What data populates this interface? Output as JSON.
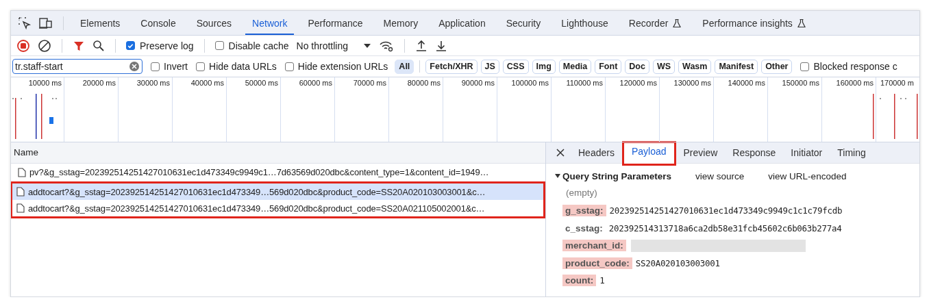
{
  "main_tabs": [
    {
      "label": "Elements",
      "selected": false,
      "experimental": false
    },
    {
      "label": "Console",
      "selected": false,
      "experimental": false
    },
    {
      "label": "Sources",
      "selected": false,
      "experimental": false
    },
    {
      "label": "Network",
      "selected": true,
      "experimental": false
    },
    {
      "label": "Performance",
      "selected": false,
      "experimental": false
    },
    {
      "label": "Memory",
      "selected": false,
      "experimental": false
    },
    {
      "label": "Application",
      "selected": false,
      "experimental": false
    },
    {
      "label": "Security",
      "selected": false,
      "experimental": false
    },
    {
      "label": "Lighthouse",
      "selected": false,
      "experimental": false
    },
    {
      "label": "Recorder",
      "selected": false,
      "experimental": true
    },
    {
      "label": "Performance insights",
      "selected": false,
      "experimental": true
    }
  ],
  "toolbar": {
    "recording": true,
    "preserve_log": {
      "label": "Preserve log",
      "checked": true
    },
    "disable_cache": {
      "label": "Disable cache",
      "checked": false
    },
    "throttling": "No throttling"
  },
  "filter": {
    "value": "tr.staff-start",
    "checkboxes": [
      {
        "label": "Invert",
        "checked": false
      },
      {
        "label": "Hide data URLs",
        "checked": false
      },
      {
        "label": "Hide extension URLs",
        "checked": false
      }
    ],
    "types": [
      {
        "label": "All",
        "selected": true
      },
      {
        "label": "Fetch/XHR",
        "selected": false
      },
      {
        "label": "JS",
        "selected": false
      },
      {
        "label": "CSS",
        "selected": false
      },
      {
        "label": "Img",
        "selected": false
      },
      {
        "label": "Media",
        "selected": false
      },
      {
        "label": "Font",
        "selected": false
      },
      {
        "label": "Doc",
        "selected": false
      },
      {
        "label": "WS",
        "selected": false
      },
      {
        "label": "Wasm",
        "selected": false
      },
      {
        "label": "Manifest",
        "selected": false
      },
      {
        "label": "Other",
        "selected": false
      }
    ],
    "blocked": {
      "label": "Blocked response c",
      "checked": false
    }
  },
  "timeline": {
    "ticks": [
      "10000 ms",
      "20000 ms",
      "30000 ms",
      "40000 ms",
      "50000 ms",
      "60000 ms",
      "70000 ms",
      "80000 ms",
      "90000 ms",
      "100000 ms",
      "110000 ms",
      "120000 ms",
      "130000 ms",
      "140000 ms",
      "150000 ms",
      "160000 ms",
      "170000 m"
    ]
  },
  "requests": {
    "column": "Name",
    "rows": [
      {
        "name": "pv?&g_sstag=202392514251427010631ec1d473349c9949c1…7d63569d020dbc&content_type=1&content_id=1949…",
        "selected": false,
        "outlined": false
      },
      {
        "name": "addtocart?&g_sstag=202392514251427010631ec1d473349…569d020dbc&product_code=SS20A020103003001&c…",
        "selected": true,
        "outlined": true
      },
      {
        "name": "addtocart?&g_sstag=202392514251427010631ec1d473349…569d020dbc&product_code=SS20A021105002001&c…",
        "selected": false,
        "outlined": true
      }
    ]
  },
  "details": {
    "tabs": [
      {
        "label": "Headers",
        "selected": false,
        "outlined": false
      },
      {
        "label": "Payload",
        "selected": true,
        "outlined": true
      },
      {
        "label": "Preview",
        "selected": false,
        "outlined": false
      },
      {
        "label": "Response",
        "selected": false,
        "outlined": false
      },
      {
        "label": "Initiator",
        "selected": false,
        "outlined": false
      },
      {
        "label": "Timing",
        "selected": false,
        "outlined": false
      }
    ],
    "section": {
      "title": "Query String Parameters",
      "expanded": true,
      "links": [
        "view source",
        "view URL-encoded"
      ],
      "empty_note": "(empty)",
      "params": [
        {
          "key": "g_sstag:",
          "value": "202392514251427010631ec1d473349c9949c1c1c79fcdb",
          "highlighted": true,
          "redacted": false
        },
        {
          "key": "c_sstag:",
          "value": "202392514313718a6ca2db58e31fcb45602c6b063b277a4",
          "highlighted": false,
          "redacted": false
        },
        {
          "key": "merchant_id:",
          "highlighted": true,
          "redacted": true
        },
        {
          "key": "product_code:",
          "value": "SS20A020103003001",
          "highlighted": true,
          "redacted": false
        },
        {
          "key": "count:",
          "value": "1",
          "highlighted": true,
          "redacted": false
        }
      ]
    }
  }
}
